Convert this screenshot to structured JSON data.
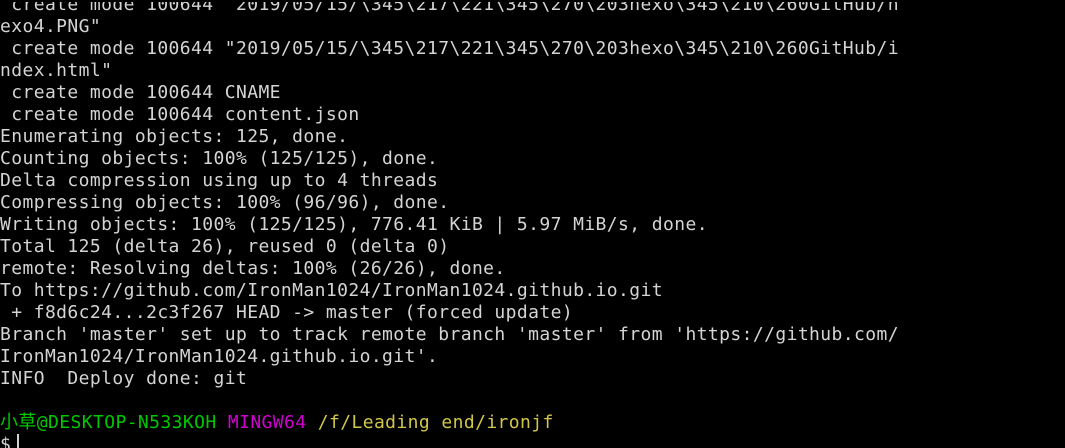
{
  "terminal": {
    "lines": [
      " create mode 100644 \"2019/05/15/\\345\\217\\221\\345\\270\\203hexo\\345\\210\\260GitHub/h",
      "exo4.PNG\"",
      " create mode 100644 \"2019/05/15/\\345\\217\\221\\345\\270\\203hexo\\345\\210\\260GitHub/i",
      "ndex.html\"",
      " create mode 100644 CNAME",
      " create mode 100644 content.json",
      "Enumerating objects: 125, done.",
      "Counting objects: 100% (125/125), done.",
      "Delta compression using up to 4 threads",
      "Compressing objects: 100% (96/96), done.",
      "Writing objects: 100% (125/125), 776.41 KiB | 5.97 MiB/s, done.",
      "Total 125 (delta 26), reused 0 (delta 0)",
      "remote: Resolving deltas: 100% (26/26), done.",
      "To https://github.com/IronMan1024/IronMan1024.github.io.git",
      " + f8d6c24...2c3f267 HEAD -> master (forced update)",
      "Branch 'master' set up to track remote branch 'master' from 'https://github.com/",
      "IronMan1024/IronMan1024.github.io.git'.",
      "INFO  Deploy done: git"
    ],
    "prompt": {
      "user_host": "小草@DESKTOP-N533KOH",
      "env": "MINGW64",
      "path": "/f/Leading end/ironjf",
      "symbol": "$"
    },
    "colors": {
      "background": "#000000",
      "text": "#d4d4d4",
      "user_host": "#00c800",
      "env": "#d000d0",
      "path": "#d2c64a"
    }
  }
}
